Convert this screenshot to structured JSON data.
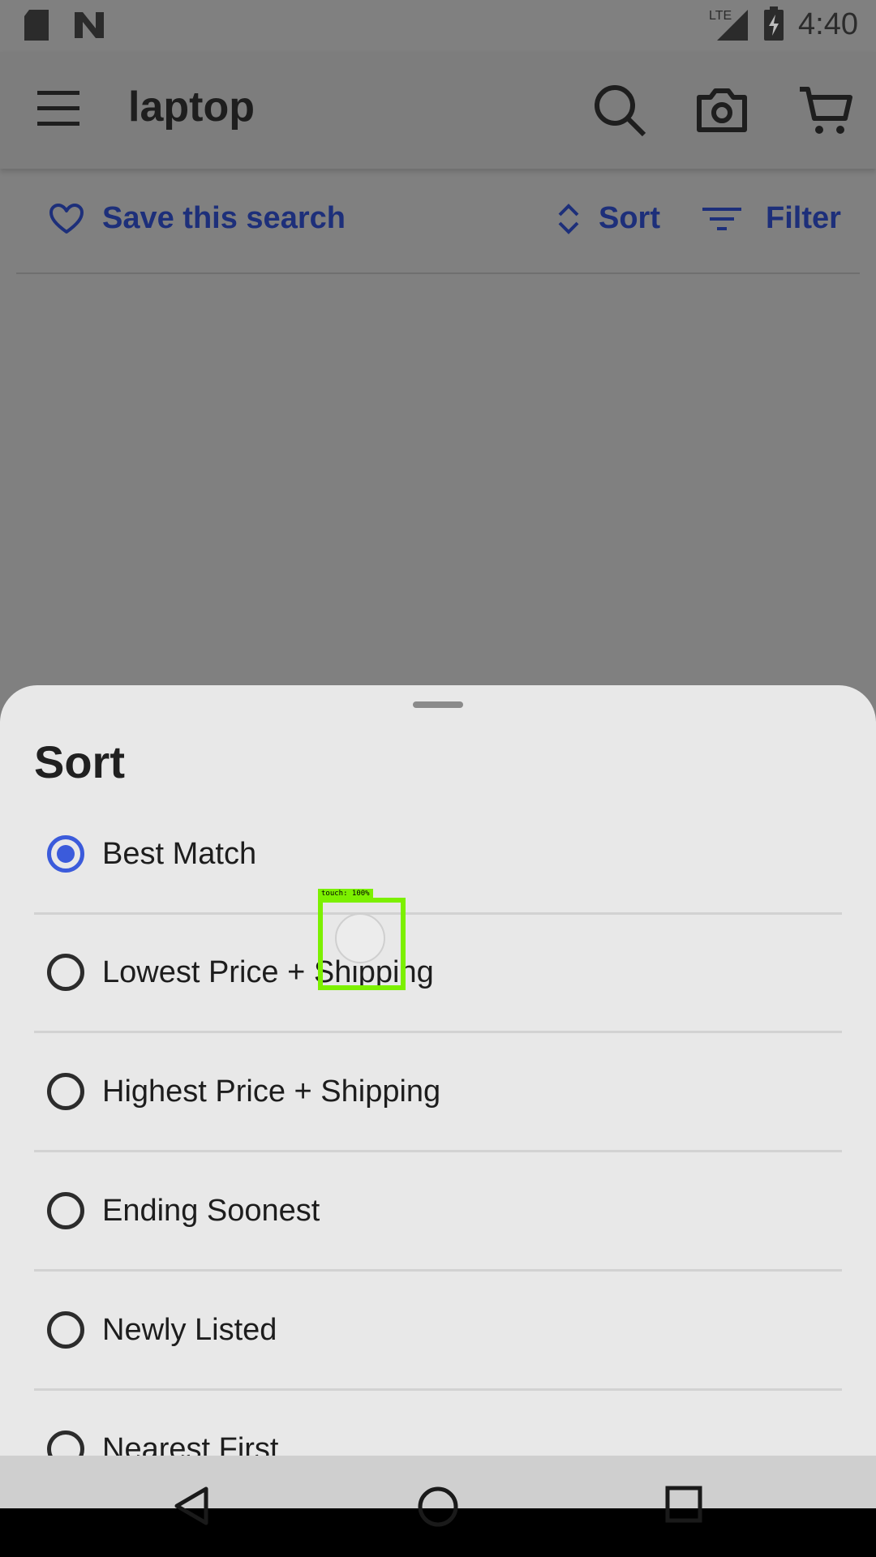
{
  "status": {
    "time": "4:40",
    "network": "LTE",
    "icons": [
      "sd-card-icon",
      "n-icon",
      "signal-icon",
      "battery-charging-icon"
    ]
  },
  "appbar": {
    "title": "laptop",
    "icons": [
      "menu-icon",
      "search-icon",
      "camera-icon",
      "cart-icon"
    ]
  },
  "toolbar": {
    "save_label": "Save this search",
    "sort_label": "Sort",
    "filter_label": "Filter"
  },
  "sheet": {
    "title": "Sort",
    "options": [
      {
        "label": "Best Match",
        "selected": true
      },
      {
        "label": "Lowest Price + Shipping",
        "selected": false
      },
      {
        "label": "Highest Price + Shipping",
        "selected": false
      },
      {
        "label": "Ending Soonest",
        "selected": false
      },
      {
        "label": "Newly Listed",
        "selected": false
      },
      {
        "label": "Nearest First",
        "selected": false
      }
    ]
  },
  "touch_overlay": {
    "label": "touch: 100%"
  },
  "colors": {
    "accent": "#3b5bdb",
    "link": "#1d2f7a",
    "touch": "#7cf000"
  }
}
